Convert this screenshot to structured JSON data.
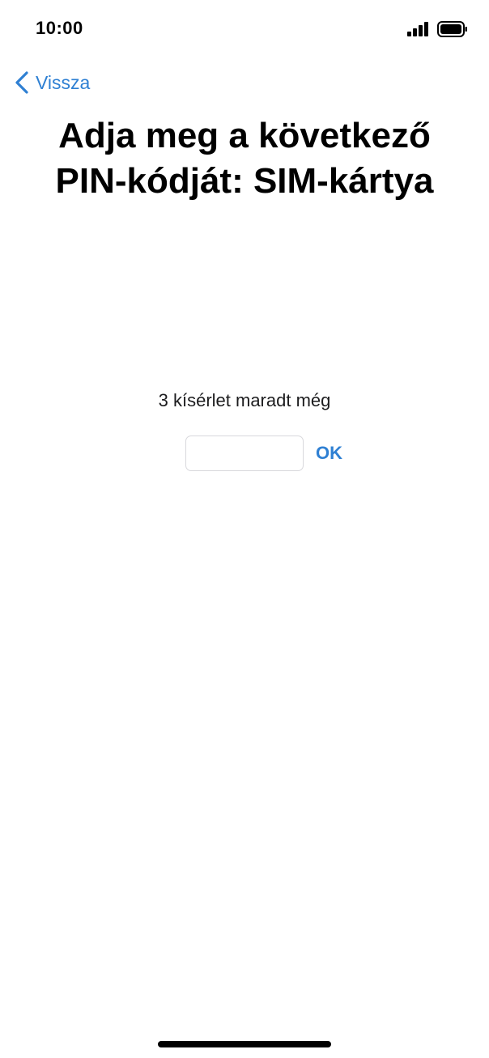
{
  "status_bar": {
    "time": "10:00",
    "signal_icon": "cellular-signal-icon",
    "battery_icon": "battery-icon"
  },
  "nav": {
    "back_label": "Vissza",
    "back_icon": "chevron-left-icon"
  },
  "title": {
    "line1": "Adja meg a következő",
    "line2": "PIN-kódját: SIM-kártya"
  },
  "pin_form": {
    "attempts_text": "3 kísérlet maradt még",
    "input_value": "",
    "ok_label": "OK"
  },
  "colors": {
    "accent": "#2f80d3",
    "background": "#ffffff",
    "text": "#000000",
    "input_border": "#d8d8dc"
  }
}
